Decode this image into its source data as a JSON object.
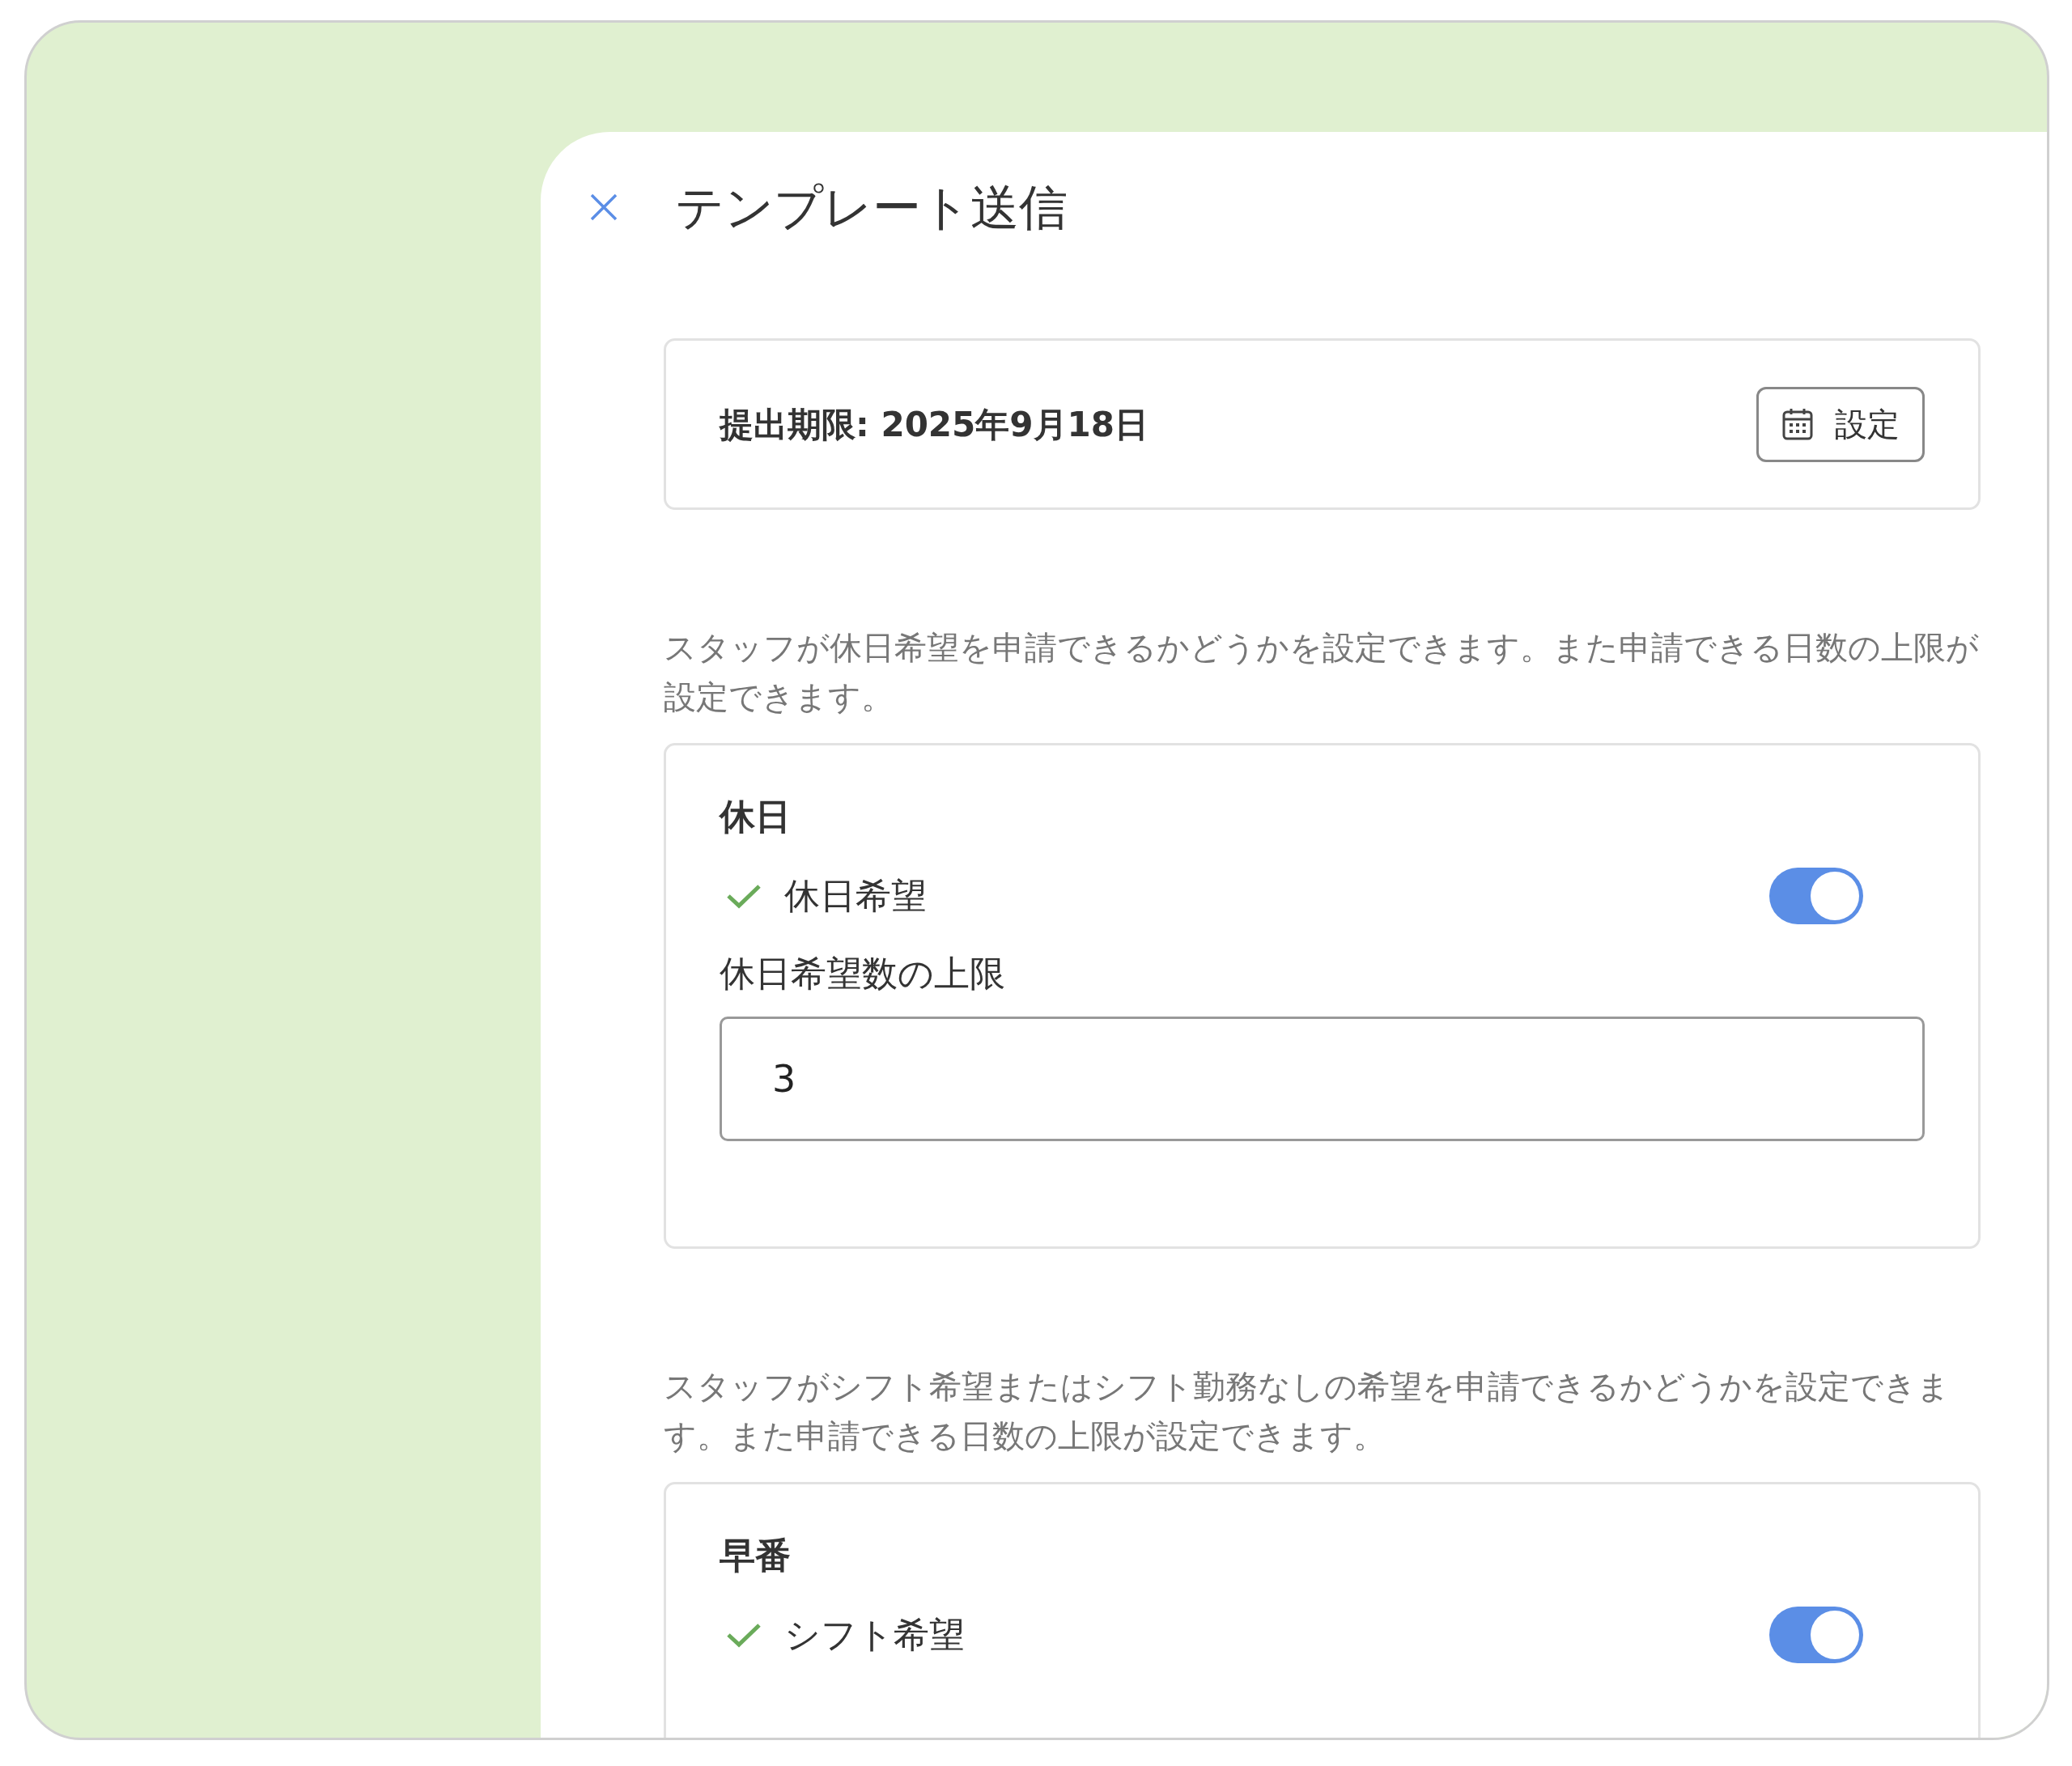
{
  "header": {
    "title": "テンプレート送信"
  },
  "deadline": {
    "label": "提出期限: 2025年9月18日",
    "button": "設定"
  },
  "sections": [
    {
      "description": "スタッフが休日希望を申請できるかどうかを設定できます。また申請できる日数の上限が設定できます。",
      "title": "休日",
      "toggle": {
        "label": "休日希望",
        "on": true
      },
      "limit": {
        "label": "休日希望数の上限",
        "value": "3"
      }
    },
    {
      "description": "スタッフがシフト希望またはシフト勤務なしの希望を申請できるかどうかを設定できます。また申請できる日数の上限が設定できます。",
      "title": "早番",
      "toggle": {
        "label": "シフト希望",
        "on": true
      }
    }
  ]
}
